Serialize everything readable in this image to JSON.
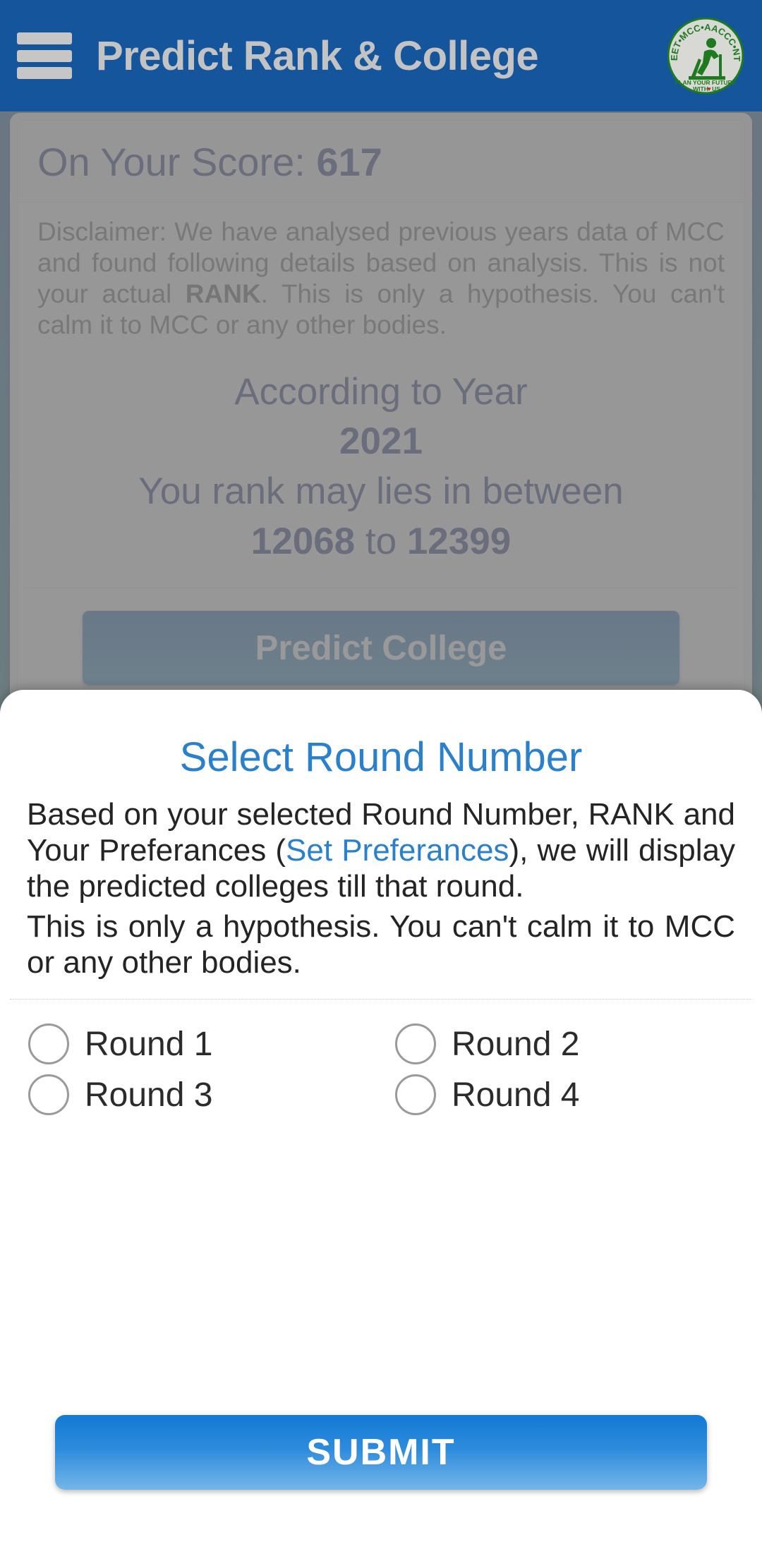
{
  "appbar": {
    "menu_icon": "hamburger-menu-icon",
    "title": "Predict Rank & College",
    "logo_icon": "neet-mcc-aaccc-nta-logo",
    "logo_text_top": "NEET•MCC•AACCC•NTA",
    "logo_text_bottom_1": "PLAN YOUR FUTURE",
    "logo_text_bottom_2": "WITH",
    "logo_text_bottom_3": "US",
    "background_color": "#14559b"
  },
  "result_card": {
    "score_label": "On Your Score:",
    "score_value": "617",
    "disclaimer_part_1": "Disclaimer: We have analysed previous years data of MCC and found following details based on analysis. This is not your actual ",
    "disclaimer_bold": "RANK",
    "disclaimer_part_2": ". This is only a hypothesis. You can't calm it to MCC or any other bodies.",
    "according_label": "According to Year",
    "year": "2021",
    "rank_label": "You rank may lies in between",
    "rank_from": "12068",
    "rank_joiner": "to",
    "rank_to": "12399",
    "predict_college_label": "Predict College"
  },
  "bottom_sheet": {
    "title": "Select Round Number",
    "desc_part_1": "Based on your selected Round Number, RANK and Your Preferances (",
    "desc_link": "Set Preferances",
    "desc_part_2": "), we will display the predicted colleges till that round.",
    "desc_line_2": "This is only a hypothesis. You can't calm it to MCC or any other bodies.",
    "rounds": [
      {
        "label": "Round 1",
        "selected": false
      },
      {
        "label": "Round 2",
        "selected": false
      },
      {
        "label": "Round 3",
        "selected": false
      },
      {
        "label": "Round 4",
        "selected": false
      }
    ],
    "submit_label": "SUBMIT"
  },
  "colors": {
    "appbar": "#14559b",
    "primary_blue": "#2a80cb",
    "dark_navy": "#10256e",
    "submit_gradient_top": "#1379d4",
    "submit_gradient_bottom": "#74b6e8",
    "logo_green": "#1f7a1f"
  }
}
